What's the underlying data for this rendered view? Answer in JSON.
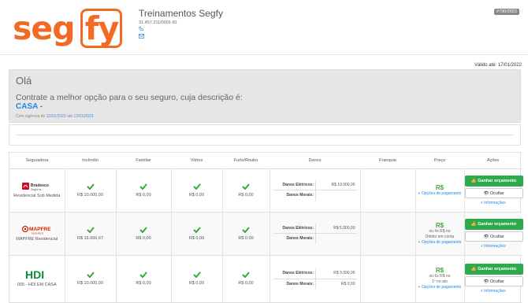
{
  "brand": {
    "logo_left": "seg",
    "logo_right": "fy",
    "color": "#f26a23"
  },
  "company": {
    "name": "Treinamentos Segfy",
    "cnpj": "31.457.211/0001-81"
  },
  "quote_badge": "#790/2022",
  "valid_until": "Válido até: 17/01/2022",
  "hero": {
    "greeting": "Olá",
    "text": "Contrate a melhor opção para o seu seguro, cuja descrição é:",
    "product": "CASA -",
    "dates_prefix": "Com vigência de",
    "date_from": "12/01/2022",
    "dates_mid": "até",
    "date_to": "12/01/2023"
  },
  "table": {
    "headers": [
      "Seguradora",
      "Incêndio",
      "Familiar",
      "Vidros",
      "Furto/Roubo",
      "Danos",
      "Franquia",
      "Preço",
      "Ações"
    ],
    "rows": [
      {
        "insurer": "Residencial Sob Medida",
        "logo": "Bradesco Seguros",
        "fire": "R$ 10.000,00",
        "family": "R$ 0,00",
        "glass": "R$ 0,00",
        "theft": "R$ 0,00",
        "dmg_elec_label": "Danos Elétricos:",
        "dmg_elec": "R$ 10.000,00",
        "dmg_moral_label": "Danos Morais:",
        "dmg_moral": "",
        "price": "R$",
        "installment": "",
        "installment2": "",
        "options": "+ Opções de pagamento"
      },
      {
        "insurer": "MAPFRE Residencial",
        "logo": "MAPFRE SEGUROS",
        "fire": "R$ 16.666,67",
        "family": "R$ 0,00",
        "glass": "R$ 0,00",
        "theft": "R$ 0,00",
        "dmg_elec_label": "Danos Elétricos:",
        "dmg_elec": "R$ 5.000,00",
        "dmg_moral_label": "Danos Morais:",
        "dmg_moral": "",
        "price": "R$",
        "installment": "ou 4x R$ no",
        "installment2": "Débito em conta",
        "options": "+ Opções de pagamento"
      },
      {
        "insurer": "005 - HDI EM CASA",
        "logo": "HDI",
        "fire": "R$ 10.000,00",
        "family": "R$ 0,00",
        "glass": "R$ 0,00",
        "theft": "R$ 0,00",
        "dmg_elec_label": "Danos Elétricos:",
        "dmg_elec": "R$ 3.000,00",
        "dmg_moral_label": "Danos Morais:",
        "dmg_moral": "R$ 0,00",
        "price": "R$",
        "installment": "ou 6x R$ no",
        "installment2": "1º no ato",
        "options": "+ Opções de pagamento"
      }
    ],
    "actions": {
      "quote_label": "Ganhar orçamento",
      "hide_label": "Ocultar",
      "info_label": "+ Informações"
    }
  },
  "colors": {
    "accent_green": "#2eaa4e",
    "link_blue": "#1e88e5",
    "hero_bg": "#e6e6e6"
  }
}
